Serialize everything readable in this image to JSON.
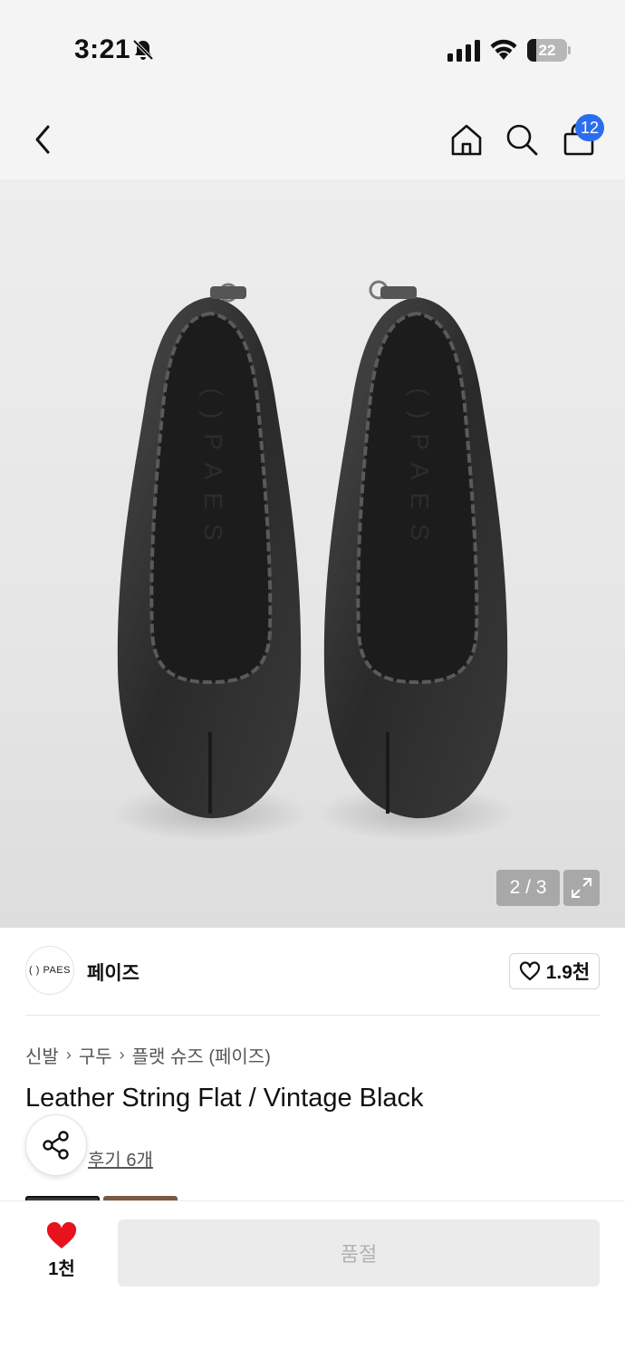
{
  "status_bar": {
    "time": "3:21",
    "battery": "22",
    "battery_level": 0.22
  },
  "nav": {
    "icons": [
      "chevron-left-icon",
      "home-icon",
      "search-icon",
      "shopping-bag-icon"
    ],
    "cart_count": "12"
  },
  "gallery": {
    "counter": "2 / 3",
    "current": 2,
    "total": 3,
    "insole_text": "( ) P A E S"
  },
  "brand": {
    "logo_text": "( ) PAES",
    "name": "페이즈",
    "likes": "1.9천"
  },
  "breadcrumb": [
    "신발",
    "구두",
    "플랫 슈즈 (페이즈)"
  ],
  "product": {
    "title": "Leather String Flat / Vintage Black"
  },
  "reviews": {
    "link": "후기 6개"
  },
  "bottom": {
    "wish_count": "1천",
    "soldout_label": "품절"
  },
  "colors": {
    "accent": "#2b6df0",
    "heart": "#e8121c",
    "soldout_bg": "#ebebeb"
  }
}
